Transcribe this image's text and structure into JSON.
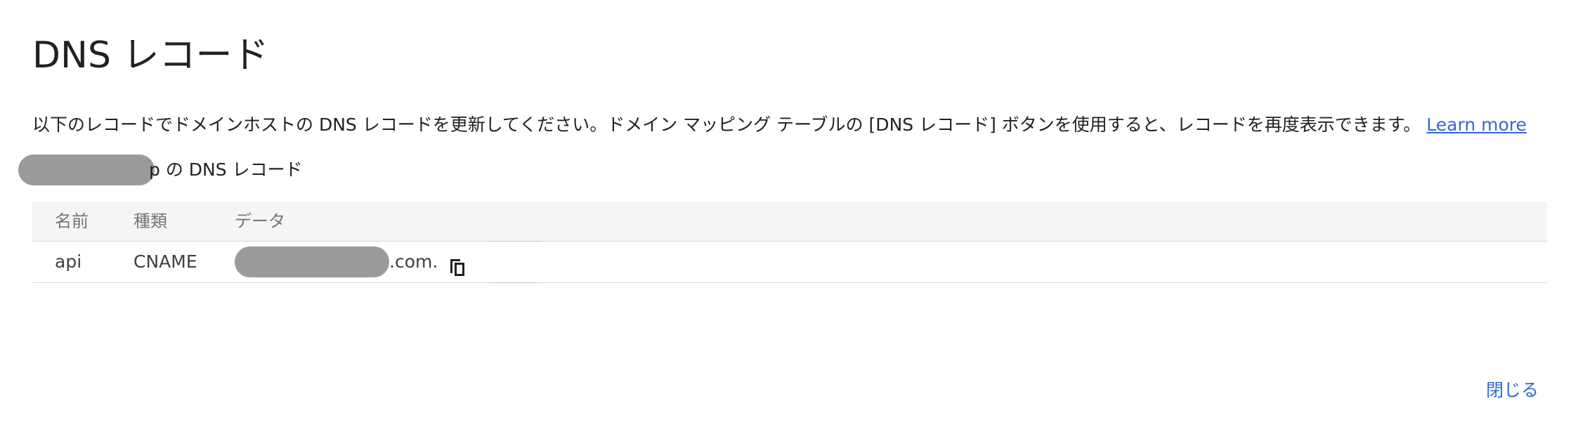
{
  "dialog": {
    "title": "DNS レコード",
    "description": "以下のレコードでドメインホストの DNS レコードを更新してください。ドメイン マッピング テーブルの [DNS レコード] ボタンを使用すると、レコードを再度表示できます。",
    "learn_more": "Learn more",
    "subtitle_suffix": "p の DNS レコード",
    "table": {
      "headers": [
        "名前",
        "種類",
        "データ"
      ],
      "rows": [
        {
          "name": "api",
          "type": "CNAME",
          "data_suffix": ".com."
        }
      ]
    },
    "close_label": "閉じる"
  },
  "icons": {
    "copy": "copy-icon"
  },
  "colors": {
    "link": "#3367d6",
    "redaction": "#9a9a9a",
    "header_bg": "#f5f5f5"
  }
}
